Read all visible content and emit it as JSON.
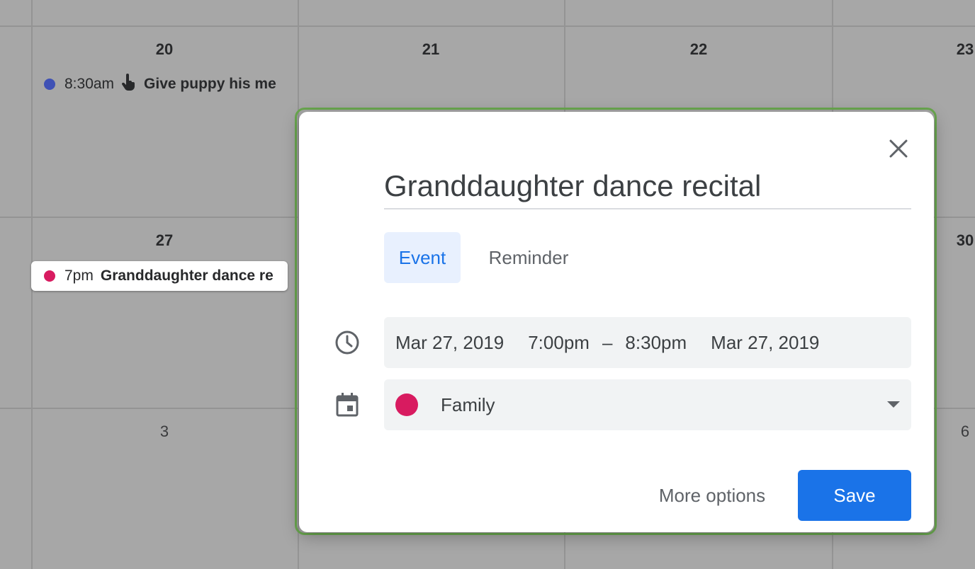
{
  "calendar": {
    "row1_days": [
      "20",
      "21",
      "22",
      "23"
    ],
    "row2_days": [
      "27",
      "30"
    ],
    "row3_days": [
      "3",
      "6"
    ],
    "events": [
      {
        "time": "8:30am",
        "title": "Give puppy his me",
        "color": "#3f51b5",
        "icon": "hand-pointer-icon"
      },
      {
        "time": "7pm",
        "title": "Granddaughter dance re",
        "color": "#d81b60"
      }
    ]
  },
  "dialog": {
    "title_value": "Granddaughter dance recital",
    "tabs": [
      {
        "label": "Event",
        "active": true
      },
      {
        "label": "Reminder",
        "active": false
      }
    ],
    "start_date": "Mar 27, 2019",
    "start_time": "7:00pm",
    "separator": "–",
    "end_time": "8:30pm",
    "end_date": "Mar 27, 2019",
    "calendar_name": "Family",
    "calendar_color": "#d81b60",
    "more_options_label": "More options",
    "save_label": "Save",
    "accent_color": "#1a73e8"
  }
}
